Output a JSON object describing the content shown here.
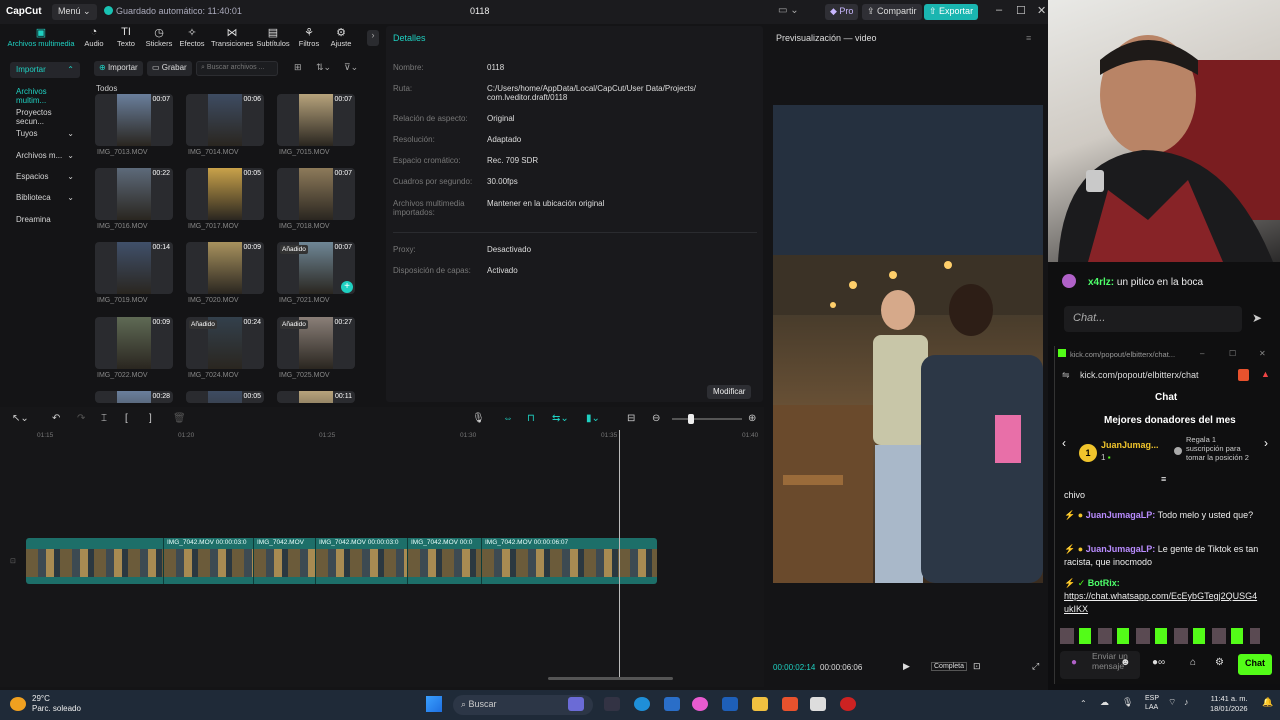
{
  "capcut": {
    "logo": "CapCut",
    "menu": "Menú",
    "autosave": "Guardado automático: 11:40:01",
    "project_name": "0118",
    "pro": "Pro",
    "share": "Compartir",
    "export": "Exportar"
  },
  "toolbar": [
    {
      "label": "Archivos multimedia",
      "icon": "media-icon"
    },
    {
      "label": "Audio",
      "icon": "audio-icon"
    },
    {
      "label": "Texto",
      "icon": "text-icon"
    },
    {
      "label": "Stickers",
      "icon": "sticker-icon"
    },
    {
      "label": "Efectos",
      "icon": "effects-icon"
    },
    {
      "label": "Transiciones",
      "icon": "transitions-icon"
    },
    {
      "label": "Subtítulos",
      "icon": "subtitles-icon"
    },
    {
      "label": "Filtros",
      "icon": "filters-icon"
    },
    {
      "label": "Ajuste",
      "icon": "adjust-icon"
    }
  ],
  "leftnav": [
    "Importar",
    "Archivos multim...",
    "Proyectos secun...",
    "Tuyos",
    "Archivos m...",
    "Espacios",
    "Biblioteca",
    "Dreamina"
  ],
  "media": {
    "import": "Importar",
    "record": "Grabar",
    "search_placeholder": "Buscar archivos ...",
    "section": "Todos",
    "added_label": "Añadido",
    "items": [
      {
        "name": "IMG_7013.MOV",
        "dur": "00:07"
      },
      {
        "name": "IMG_7014.MOV",
        "dur": "00:06"
      },
      {
        "name": "IMG_7015.MOV",
        "dur": "00:07"
      },
      {
        "name": "IMG_7016.MOV",
        "dur": "00:22"
      },
      {
        "name": "IMG_7017.MOV",
        "dur": "00:05"
      },
      {
        "name": "IMG_7018.MOV",
        "dur": "00:07"
      },
      {
        "name": "IMG_7019.MOV",
        "dur": "00:14"
      },
      {
        "name": "IMG_7020.MOV",
        "dur": "00:09"
      },
      {
        "name": "IMG_7021.MOV",
        "dur": "00:07"
      },
      {
        "name": "IMG_7022.MOV",
        "dur": "00:09"
      },
      {
        "name": "IMG_7024.MOV",
        "dur": "00:24"
      },
      {
        "name": "IMG_7025.MOV",
        "dur": "00:27"
      },
      {
        "name": "",
        "dur": "00:28"
      },
      {
        "name": "",
        "dur": "00:05"
      },
      {
        "name": "",
        "dur": "00:11"
      }
    ]
  },
  "details": {
    "title": "Detalles",
    "rows": [
      {
        "k": "Nombre:",
        "v": "0118"
      },
      {
        "k": "Ruta:",
        "v": "C:/Users/home/AppData/Local/CapCut/User Data/Projects/ com.lveditor.draft/0118"
      },
      {
        "k": "Relación de aspecto:",
        "v": "Original"
      },
      {
        "k": "Resolución:",
        "v": "Adaptado"
      },
      {
        "k": "Espacio cromático:",
        "v": "Rec. 709 SDR"
      },
      {
        "k": "Cuadros por segundo:",
        "v": "30.00fps"
      },
      {
        "k": "Archivos multimedia importados:",
        "v": "Mantener en la ubicación original"
      },
      {
        "k": "Proxy:",
        "v": "Desactivado"
      },
      {
        "k": "Disposición de capas:",
        "v": "Activado"
      }
    ],
    "modify": "Modificar"
  },
  "preview": {
    "title": "Previsualización — video",
    "time_current": "00:00:02:14",
    "time_total": "00:00:06:06",
    "complete": "Completa"
  },
  "timeline": {
    "ruler": [
      "01:15",
      "01:20",
      "01:25",
      "01:30",
      "01:35",
      "01:40"
    ],
    "clips": [
      {
        "label": ""
      },
      {
        "label": "IMG_7042.MOV  00:00:03:0"
      },
      {
        "label": "IMG_7042.MOV"
      },
      {
        "label": "IMG_7042.MOV  00:00:03:0"
      },
      {
        "label": "IMG_7042.MOV  00:0"
      },
      {
        "label": "IMG_7042.MOV  00:00:06:07"
      }
    ]
  },
  "stream_chat": {
    "user": "x4rlz:",
    "message": "un pitico en la boca",
    "input_placeholder": "Chat..."
  },
  "kick": {
    "window_title": "kick.com/popout/elbitterx/chat...",
    "url": "kick.com/popout/elbitterx/chat",
    "chat_title": "Chat",
    "donors_title": "Mejores donadores del mes",
    "top_donor": "JuanJumag...",
    "top_count": "1",
    "gift_text": "Regala 1 suscripción para tomar la posición 2",
    "messages": [
      {
        "user": "",
        "text": "chivo"
      },
      {
        "user": "JuanJumagaLP:",
        "text": "Todo melo y usted que?"
      },
      {
        "user": "JuanJumagaLP:",
        "text": "Le gente de Tiktok es tan racista, que inocmodo"
      },
      {
        "user": "BotRix:",
        "text": "https://chat.whatsapp.com/EcEybGTegj2QUSG4ukIKX"
      }
    ],
    "send_placeholder": "Enviar un mensaje",
    "chat_button": "Chat"
  },
  "taskbar": {
    "temp": "29°C",
    "weather": "Parc. soleado",
    "search": "Buscar",
    "lang1": "ESP",
    "lang2": "LAA",
    "time": "11:41 a. m.",
    "date": "18/01/2026"
  },
  "colors": {
    "accent": "#1fd0c1",
    "kick_green": "#53fc18",
    "username": "#b98cff"
  }
}
